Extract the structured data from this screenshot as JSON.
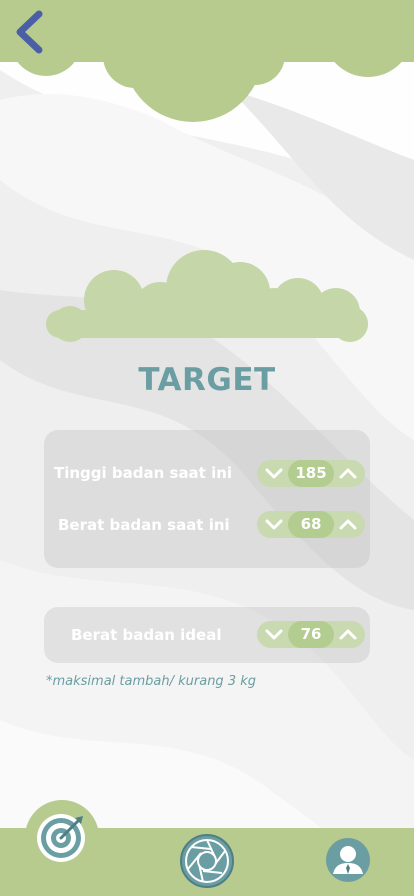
{
  "header": {
    "back_icon": "chevron-left-icon"
  },
  "title": "TARGET",
  "current": {
    "rows": [
      {
        "label": "Tinggi badan saat ini",
        "value": "185"
      },
      {
        "label": "Berat badan saat ini",
        "value": "68"
      }
    ]
  },
  "ideal": {
    "label": "Berat badan ideal",
    "value": "76"
  },
  "note": "*maksimal tambah/ kurang 3 kg",
  "nav": {
    "items": [
      {
        "icon": "target-icon",
        "active": true
      },
      {
        "icon": "camera-shutter-icon",
        "active": false
      },
      {
        "icon": "profile-icon",
        "active": false
      }
    ]
  },
  "colors": {
    "cloud_green": "#b7cb8f",
    "accent_teal": "#6a9ea3",
    "back_blue": "#4a5fa6",
    "stepper_bg": "#c9d9b0",
    "stepper_value_bg": "#b3cc8f"
  }
}
